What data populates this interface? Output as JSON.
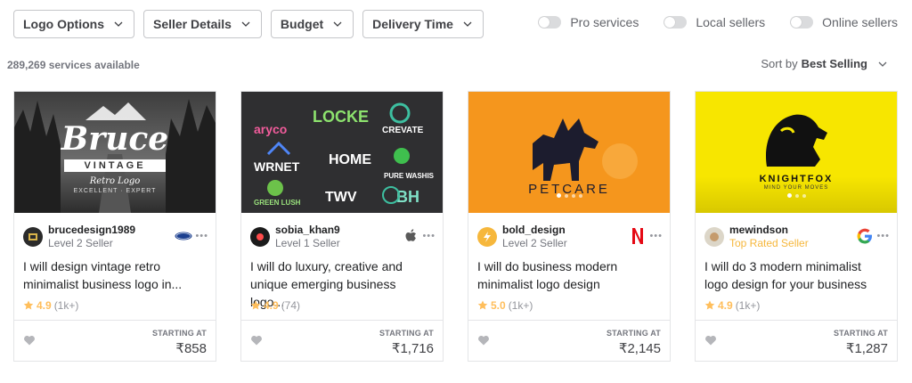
{
  "filters": [
    {
      "label": "Logo Options"
    },
    {
      "label": "Seller Details"
    },
    {
      "label": "Budget"
    },
    {
      "label": "Delivery Time"
    }
  ],
  "toggles": [
    {
      "label": "Pro services"
    },
    {
      "label": "Local sellers"
    },
    {
      "label": "Online sellers"
    }
  ],
  "results_count": "289,269 services available",
  "sort": {
    "prefix": "Sort by",
    "value": "Best Selling"
  },
  "starting_label": "STARTING AT",
  "cards": [
    {
      "seller": "brucedesign1989",
      "level": "Level 2 Seller",
      "title": "I will design vintage retro minimalist business logo in...",
      "rating": "4.9",
      "reviews": "(1k+)",
      "price": "₹858",
      "brand_icon": "ford-icon",
      "thumb_texts": {
        "main": "Bruce",
        "banner": "VINTAGE",
        "sub": "Retro Logo",
        "tag": "EXCELLENT · EXPERT"
      }
    },
    {
      "seller": "sobia_khan9",
      "level": "Level 1 Seller",
      "title": "I will do luxury, creative and unique emerging business logo...",
      "rating": "4.9",
      "reviews": "(74)",
      "price": "₹1,716",
      "brand_icon": "apple-icon",
      "thumb_texts": {
        "l1": "aryco",
        "l2": "LOCKE",
        "l3": "CREVATE",
        "l4": "WRNET",
        "l5": "HOME",
        "l6": "PURE WASHIS",
        "l7": "GREEN LUSH",
        "l8": "TWV",
        "l9": "BH"
      }
    },
    {
      "seller": "bold_design",
      "level": "Level 2 Seller",
      "title": "I will do business modern minimalist logo design",
      "rating": "5.0",
      "reviews": "(1k+)",
      "price": "₹2,145",
      "brand_icon": "netflix-icon",
      "thumb_texts": {
        "main": "PETCARE"
      }
    },
    {
      "seller": "mewindson",
      "level": "Top Rated Seller",
      "title": "I will do 3 modern minimalist logo design for your business",
      "rating": "4.9",
      "reviews": "(1k+)",
      "price": "₹1,287",
      "brand_icon": "google-icon",
      "thumb_texts": {
        "main": "KNIGHTFOX",
        "sub": "MIND YOUR MOVES"
      }
    }
  ],
  "colors": {
    "star": "#ffbe5b",
    "top_rated": "#f6b73c",
    "thumb_orange": "#f5961d",
    "thumb_yellow": "#f7e600"
  }
}
